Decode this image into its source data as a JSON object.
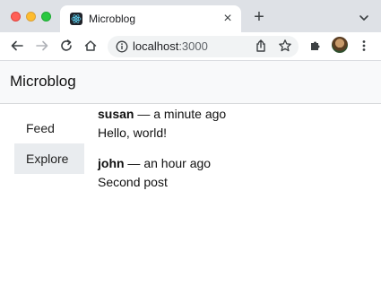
{
  "browser": {
    "tab": {
      "title": "Microblog",
      "favicon": "react-logo-icon"
    },
    "address": {
      "host": "localhost",
      "port": ":3000"
    }
  },
  "app": {
    "title": "Microblog",
    "sidebar": [
      {
        "label": "Feed",
        "active": false
      },
      {
        "label": "Explore",
        "active": true
      }
    ],
    "posts": [
      {
        "author": "susan",
        "time": "a minute ago",
        "body": "Hello, world!"
      },
      {
        "author": "john",
        "time": "an hour ago",
        "body": "Second post"
      }
    ],
    "separator": " — "
  }
}
